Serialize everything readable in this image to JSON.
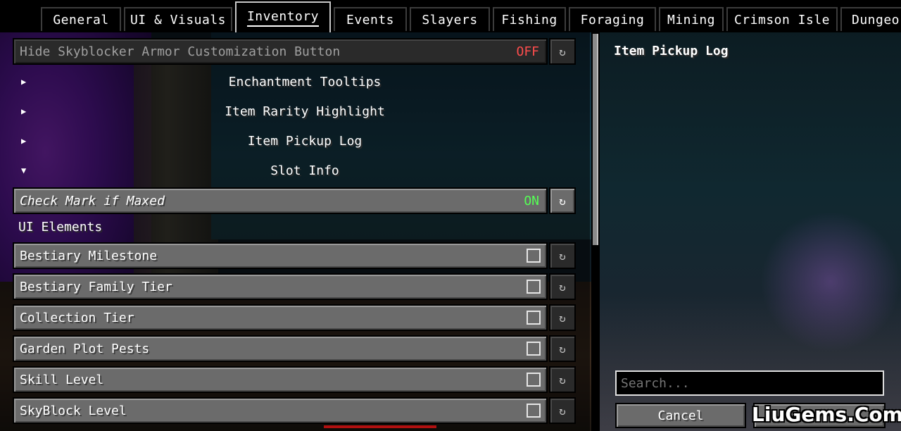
{
  "tabs": [
    {
      "label": "General",
      "active": false
    },
    {
      "label": "UI & Visuals",
      "active": false
    },
    {
      "label": "Inventory",
      "active": true
    },
    {
      "label": "Events",
      "active": false
    },
    {
      "label": "Slayers",
      "active": false
    },
    {
      "label": "Fishing",
      "active": false
    },
    {
      "label": "Foraging",
      "active": false
    },
    {
      "label": "Mining",
      "active": false
    },
    {
      "label": "Crimson Isle",
      "active": false
    },
    {
      "label": "Dungeo",
      "active": false
    }
  ],
  "options": {
    "hide_armor": {
      "label": "Hide Skyblocker Armor Customization Button",
      "value": "OFF"
    },
    "check_mark": {
      "label": "Check Mark if Maxed",
      "value": "ON"
    }
  },
  "sections": [
    {
      "label": "Enchantment Tooltips",
      "expanded": false,
      "arrow": "▶"
    },
    {
      "label": "Item Rarity Highlight",
      "expanded": false,
      "arrow": "▶"
    },
    {
      "label": "Item Pickup Log",
      "expanded": false,
      "arrow": "▶"
    },
    {
      "label": "Slot Info",
      "expanded": true,
      "arrow": "▼"
    }
  ],
  "group_label": "UI Elements",
  "ui_elements": [
    {
      "label": "Bestiary Milestone",
      "checked": false
    },
    {
      "label": "Bestiary Family Tier",
      "checked": false
    },
    {
      "label": "Collection Tier",
      "checked": false
    },
    {
      "label": "Garden Plot Pests",
      "checked": false
    },
    {
      "label": "Skill Level",
      "checked": false
    },
    {
      "label": "SkyBlock Level",
      "checked": false
    }
  ],
  "reset_icon": "↻",
  "right_panel": {
    "title": "Item Pickup Log",
    "search_placeholder": "Search...",
    "cancel_label": "Cancel"
  },
  "watermark": "LiuGems.Com"
}
